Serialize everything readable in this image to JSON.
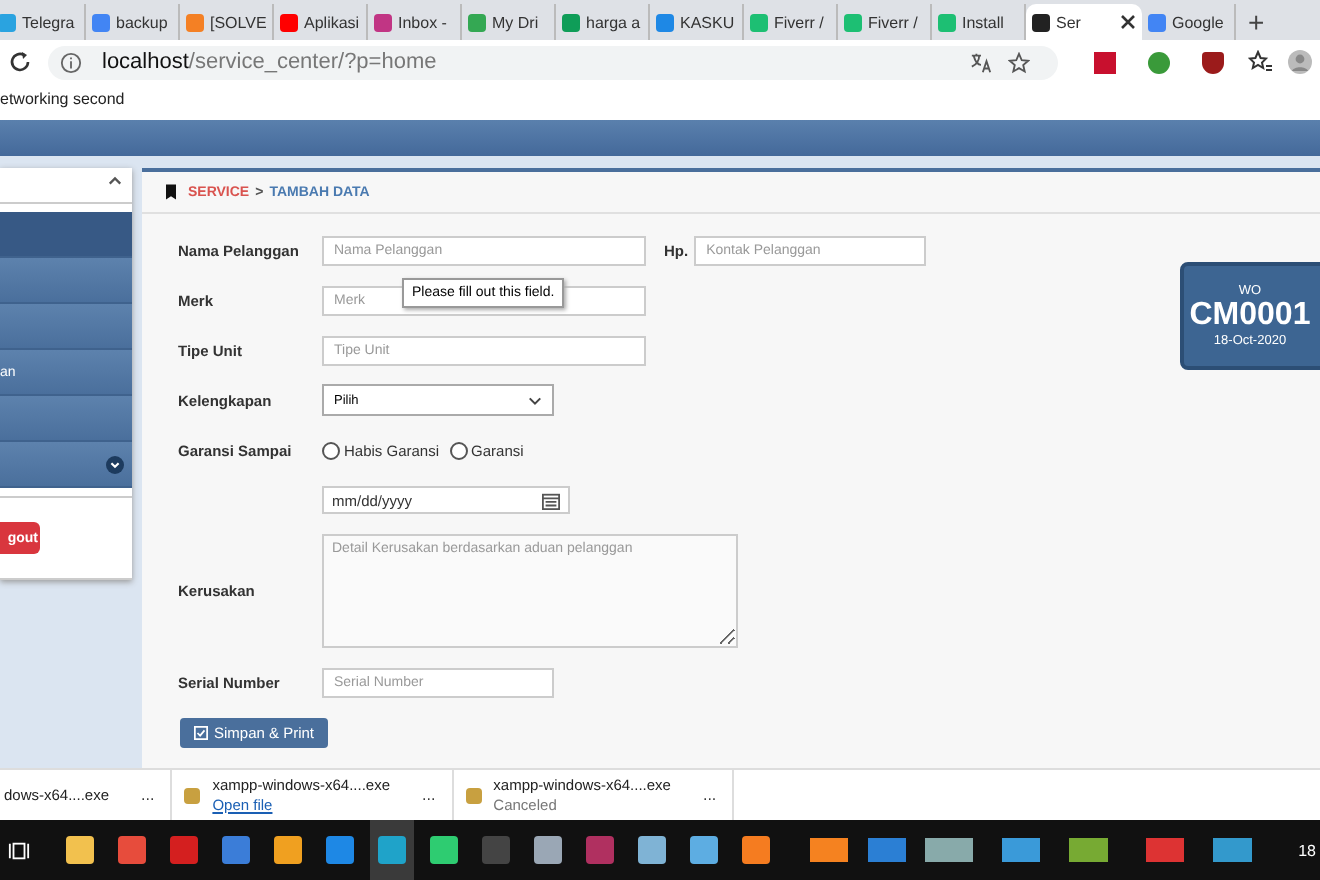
{
  "browser": {
    "tabs": [
      {
        "title": "Telegra",
        "color": "#2aa3e0",
        "selected": false
      },
      {
        "title": "backup",
        "color": "#4285f4",
        "selected": false
      },
      {
        "title": "[SOLVE",
        "color": "#f48024",
        "selected": false
      },
      {
        "title": "Aplikasi",
        "color": "#ff0000",
        "selected": false
      },
      {
        "title": "Inbox -",
        "color": "#c13584",
        "selected": false
      },
      {
        "title": "My Dri",
        "color": "#34a853",
        "selected": false
      },
      {
        "title": "harga a",
        "color": "#0f9d58",
        "selected": false
      },
      {
        "title": "KASKU",
        "color": "#1e88e5",
        "selected": false
      },
      {
        "title": "Fiverr /",
        "color": "#1dbf73",
        "selected": false
      },
      {
        "title": "Fiverr /",
        "color": "#1dbf73",
        "selected": false
      },
      {
        "title": "Install",
        "color": "#1dbf73",
        "selected": false
      },
      {
        "title": "Ser",
        "color": "#222222",
        "selected": true
      },
      {
        "title": "Google",
        "color": "#4285f4",
        "selected": false
      }
    ],
    "new_tab": "+",
    "url_host": "localhost",
    "url_path": "/service_center/?p=home",
    "bookmark": "etworking second"
  },
  "sidebar": {
    "items": [
      {
        "selected": true
      },
      {
        "selected": false
      },
      {
        "selected": false
      },
      {
        "label": "an",
        "selected": false
      },
      {
        "selected": false
      },
      {
        "selected": false,
        "kind": "expandable"
      }
    ],
    "logout": "gout"
  },
  "form": {
    "breadcrumb_section": "SERVICE",
    "breadcrumb_sep": ">",
    "breadcrumb_page": "TAMBAH DATA",
    "nama_label": "Nama Pelanggan",
    "nama_placeholder": "Nama Pelanggan",
    "hp_label": "Hp.",
    "hp_placeholder": "Kontak Pelanggan",
    "merk_label": "Merk",
    "merk_placeholder": "Merk",
    "tooltip": "Please fill out this field.",
    "tipe_label": "Tipe Unit",
    "tipe_placeholder": "Tipe Unit",
    "kelengkapan_label": "Kelengkapan",
    "kelengkapan_value": "Pilih",
    "garansi_label": "Garansi Sampai",
    "garansi_options": [
      {
        "label": "Habis Garansi",
        "selected": false
      },
      {
        "label": "Garansi",
        "selected": false
      }
    ],
    "date_placeholder": "mm/dd/yyyy",
    "kerusakan_label": "Kerusakan",
    "kerusakan_placeholder": "Detail Kerusakan berdasarkan aduan pelanggan",
    "serial_label": "Serial Number",
    "serial_placeholder": "Serial Number",
    "submit": "Simpan & Print"
  },
  "wo_card": {
    "label": "WO",
    "number": "CM0001",
    "date": "18-Oct-2020"
  },
  "downloads": [
    {
      "name": "dows-x64....exe",
      "more": "..."
    },
    {
      "name": "xampp-windows-x64....exe",
      "status": "Open file",
      "kind": "link",
      "more": "..."
    },
    {
      "name": "xampp-windows-x64....exe",
      "status": "Canceled",
      "kind": "text",
      "more": "..."
    }
  ],
  "taskbar": {
    "apps": [
      {
        "color": "#f2c14e",
        "selected": false
      },
      {
        "color": "#e74c3c",
        "selected": false
      },
      {
        "color": "#d41f1f",
        "selected": false
      },
      {
        "color": "#3b7dd8",
        "selected": false
      },
      {
        "color": "#f0a020",
        "selected": false
      },
      {
        "color": "#1e88e5",
        "selected": false
      },
      {
        "color": "#1fa3c9",
        "selected": true
      },
      {
        "color": "#2ecc71",
        "selected": false
      },
      {
        "color": "#444444",
        "selected": false
      },
      {
        "color": "#9aa7b5",
        "selected": false
      },
      {
        "color": "#b03060",
        "selected": false
      },
      {
        "color": "#7fb3d5",
        "selected": false
      },
      {
        "color": "#5dade2",
        "selected": false
      },
      {
        "color": "#f57c20",
        "selected": false
      }
    ],
    "clock": "18"
  }
}
